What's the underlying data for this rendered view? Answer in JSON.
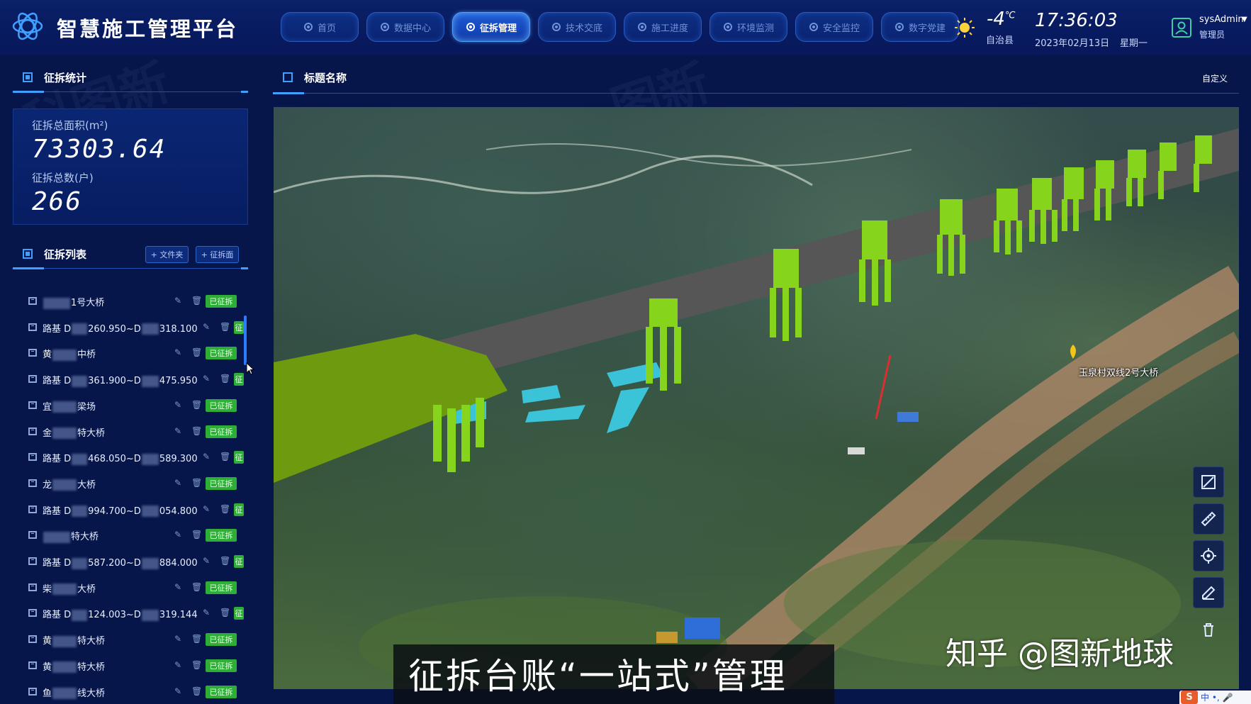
{
  "app": {
    "title": "智慧施工管理平台"
  },
  "nav": [
    {
      "label": "首页",
      "active": false
    },
    {
      "label": "数据中心",
      "active": false
    },
    {
      "label": "征拆管理",
      "active": true
    },
    {
      "label": "技术交底",
      "active": false
    },
    {
      "label": "施工进度",
      "active": false
    },
    {
      "label": "环境监测",
      "active": false
    },
    {
      "label": "安全监控",
      "active": false
    },
    {
      "label": "数字党建",
      "active": false
    }
  ],
  "weather": {
    "icon": "sun-icon",
    "temperature": "-4",
    "unit": "℃",
    "region": "自治县"
  },
  "clock": {
    "time": "17:36:03",
    "date": "2023年02月13日",
    "weekday": "星期一"
  },
  "user": {
    "name": "sysAdmin",
    "role": "管理员"
  },
  "stats_panel": {
    "title": "征拆统计",
    "area_label": "征拆总面积(m²)",
    "area_value": "73303.64",
    "households_label": "征拆总数(户)",
    "households_value": "266"
  },
  "list_panel": {
    "title": "征拆列表",
    "add_folder_label": "+ 文件夹",
    "add_polygon_label": "+ 征拆面",
    "items": [
      {
        "prefix": "",
        "suffix": "1号大桥",
        "status": "已征拆"
      },
      {
        "prefix": "路基 D",
        "middle": "260.950~D",
        "suffix": "318.100",
        "status": "已征拆"
      },
      {
        "prefix": "黄",
        "suffix": "中桥",
        "status": "已征拆"
      },
      {
        "prefix": "路基 D",
        "middle": "361.900~D",
        "suffix": "475.950",
        "status": "已征拆"
      },
      {
        "prefix": "宜",
        "suffix": "梁场",
        "status": "已征拆"
      },
      {
        "prefix": "金",
        "suffix": "特大桥",
        "status": "已征拆"
      },
      {
        "prefix": "路基 D",
        "middle": "468.050~D",
        "suffix": "589.300",
        "status": "已征拆"
      },
      {
        "prefix": "龙",
        "suffix": "大桥",
        "status": "已征拆"
      },
      {
        "prefix": "路基 D",
        "middle": "994.700~D",
        "suffix": "054.800",
        "status": "已征拆"
      },
      {
        "prefix": "",
        "suffix": "特大桥",
        "status": "已征拆"
      },
      {
        "prefix": "路基 D",
        "middle": "587.200~D",
        "suffix": "884.000",
        "status": "已征拆"
      },
      {
        "prefix": "柴",
        "suffix": "大桥",
        "status": "已征拆"
      },
      {
        "prefix": "路基 D",
        "middle": "124.003~D",
        "suffix": "319.144",
        "status": "已征拆"
      },
      {
        "prefix": "黄",
        "suffix": "特大桥",
        "status": "已征拆"
      },
      {
        "prefix": "黄",
        "suffix": "特大桥",
        "status": "已征拆"
      },
      {
        "prefix": "鱼",
        "suffix": "线大桥",
        "status": "已征拆"
      }
    ]
  },
  "main_panel": {
    "title": "标题名称",
    "custom_label": "自定义",
    "map_marker_label": "玉泉村双线2号大桥",
    "caption": "征拆台账“一站式”管理",
    "watermark": "知乎 @图新地球"
  },
  "map_tools": [
    "draw-polygon-icon",
    "measure-icon",
    "locate-icon",
    "edit-icon",
    "delete-icon"
  ],
  "ime": {
    "label": "中 •, 🎤"
  },
  "colors": {
    "accent": "#3fa0ff",
    "status_green": "#2fae37",
    "pier_green": "#7ccc1a",
    "deck_gray": "#5a5a5a"
  }
}
